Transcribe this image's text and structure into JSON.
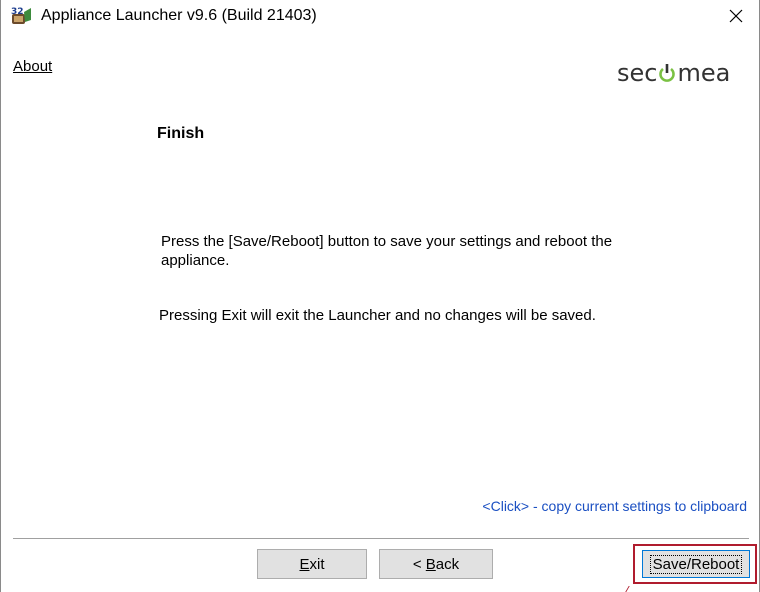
{
  "window": {
    "title": "Appliance Launcher v9.6 (Build 21403)",
    "icon": "appliance-launcher-icon",
    "close_symbol": "✕"
  },
  "menu": {
    "about": "About"
  },
  "brand": {
    "logo_text_left": "sec",
    "logo_text_right": "mea",
    "logo_color": "#333333",
    "accent": "#7ac143"
  },
  "main": {
    "heading": "Finish",
    "message_save": "Press the [Save/Reboot] button to save your settings and reboot the appliance.",
    "message_exit": "Pressing Exit will exit the Launcher and no changes will be saved.",
    "clipboard_link": "<Click> - copy current settings to clipboard"
  },
  "buttons": {
    "exit_prefix": "",
    "exit_mnemonic": "E",
    "exit_rest": "xit",
    "back_prefix": "< ",
    "back_mnemonic": "B",
    "back_rest": "ack",
    "save_reboot": "Save/Reboot"
  },
  "colors": {
    "link": "#1a4fc2",
    "highlight_border": "#b01c2e",
    "button_face": "#e1e1e1",
    "focus_border": "#0078d7"
  }
}
